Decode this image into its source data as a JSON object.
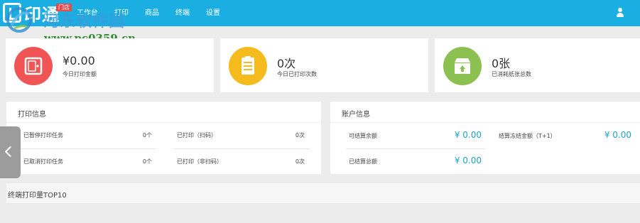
{
  "header": {
    "logo_text": "印通",
    "badge": "门店",
    "nav": [
      "工作台",
      "打印",
      "商品",
      "终端",
      "设置"
    ],
    "user_icon": "user-icon"
  },
  "watermark": {
    "title": "河东软件园",
    "url": "www.pc0359.cn"
  },
  "stats": [
    {
      "value": "¥0.00",
      "label": "今日打印金额",
      "icon": "safe-icon",
      "color": "#f05454"
    },
    {
      "value": "0次",
      "label": "今日已打印次数",
      "icon": "clipboard-icon",
      "color": "#f5ba1c"
    },
    {
      "value": "0张",
      "label": "已消耗纸张总数",
      "icon": "box-icon",
      "color": "#8cc152"
    }
  ],
  "print_info": {
    "title": "打印信息",
    "rows": [
      [
        {
          "label": "已暂停打印任务",
          "value": "0个"
        },
        {
          "label": "已打印（扫码）",
          "value": "0次"
        }
      ],
      [
        {
          "label": "已取消打印任务",
          "value": "0个"
        },
        {
          "label": "已打印（非扫码）",
          "value": "0次"
        }
      ]
    ]
  },
  "account_info": {
    "title": "账户信息",
    "rows": [
      [
        {
          "label": "可结算余额",
          "value": "¥ 0.00"
        },
        {
          "label": "结算冻结金额（T+1）",
          "value": "¥ 0.00"
        }
      ],
      [
        {
          "label": "已结算总额",
          "value": "¥ 0.00"
        }
      ]
    ]
  },
  "terminal_top": {
    "title": "终端打印量TOP10"
  }
}
